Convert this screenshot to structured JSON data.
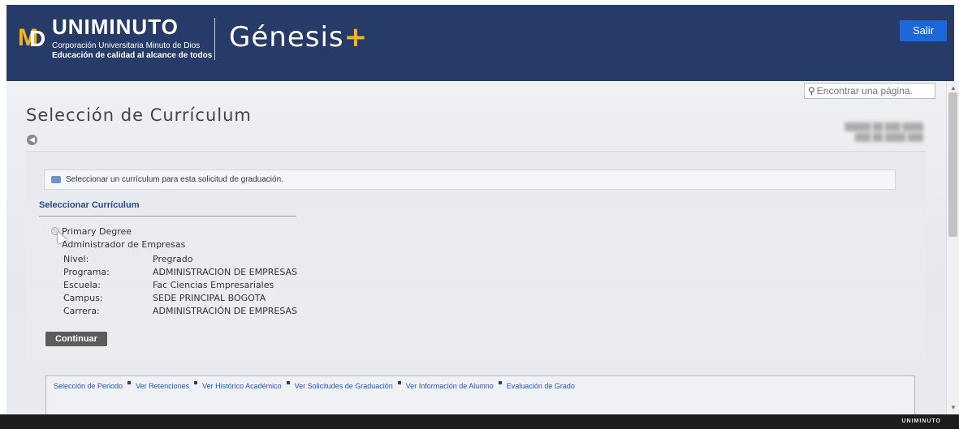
{
  "header": {
    "brand_name": "UNIMINUTO",
    "brand_sub1": "Corporación Universitaria Minuto de Dios",
    "brand_sub2": "Educación de calidad al alcance de todos",
    "app_name": "Génesis",
    "app_plus": "+",
    "logout_label": "Salir",
    "accent_color": "#f2b71a",
    "header_color": "#273b68"
  },
  "search": {
    "placeholder": "Encontrar una página."
  },
  "page": {
    "title": "Selección de Currículum"
  },
  "notice": {
    "text": "Seleccionar un currículum para esta solicitud de graduación."
  },
  "section": {
    "title": "Seleccionar Currículum"
  },
  "curriculum": {
    "title": "Primary Degree",
    "subtitle": "Administrador de Empresas",
    "fields": [
      {
        "label": "Nivel:",
        "value": "Pregrado"
      },
      {
        "label": "Programa:",
        "value": "ADMINISTRACION DE EMPRESAS"
      },
      {
        "label": "Escuela:",
        "value": "Fac Ciencias Empresariales"
      },
      {
        "label": "Campus:",
        "value": "SEDE PRINCIPAL BOGOTA"
      },
      {
        "label": "Carrera:",
        "value": "ADMINISTRACIÓN DE EMPRESAS"
      }
    ]
  },
  "actions": {
    "continue_label": "Continuar"
  },
  "nav_links": [
    "Selección de Periodo",
    "Ver Retenciones",
    "Ver Histórico Académico",
    "Ver Solicitudes de Graduación",
    "Ver Información de Alumno",
    "Evaluación de Grado"
  ],
  "footer": {
    "brand": "UNIMINUTO"
  }
}
